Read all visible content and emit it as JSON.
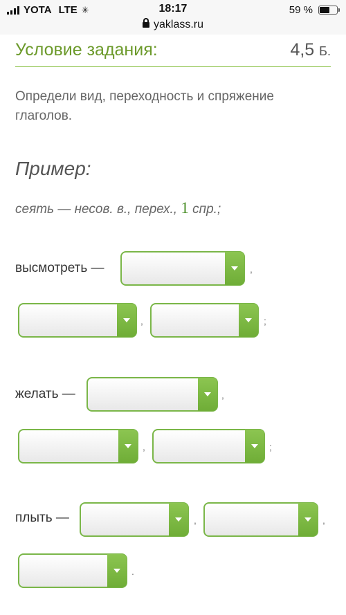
{
  "status": {
    "carrier": "YOTA",
    "network": "LTE",
    "time": "18:17",
    "battery": "59 %",
    "battery_level": 0.59,
    "url": "yaklass.ru"
  },
  "task": {
    "title": "Условие задания:",
    "score": "4,5",
    "score_unit": "Б.",
    "instruction": "Определи вид, переходность и спряжение глаголов.",
    "example_title": "Пример:",
    "example_text": "сеять — несов. в., перех., ",
    "example_num": "1",
    "example_end": " спр.;"
  },
  "exercises": [
    {
      "label": "высмотреть —",
      "sep1": ",",
      "sep2": ",",
      "end": ";"
    },
    {
      "label": "желать —",
      "sep1": ",",
      "sep2": ",",
      "end": ";"
    },
    {
      "label": "плыть —",
      "sep1": ",",
      "sep2": ",",
      "end": "."
    }
  ],
  "colors": {
    "accent": "#7ab648",
    "title": "#6c9a2b"
  }
}
